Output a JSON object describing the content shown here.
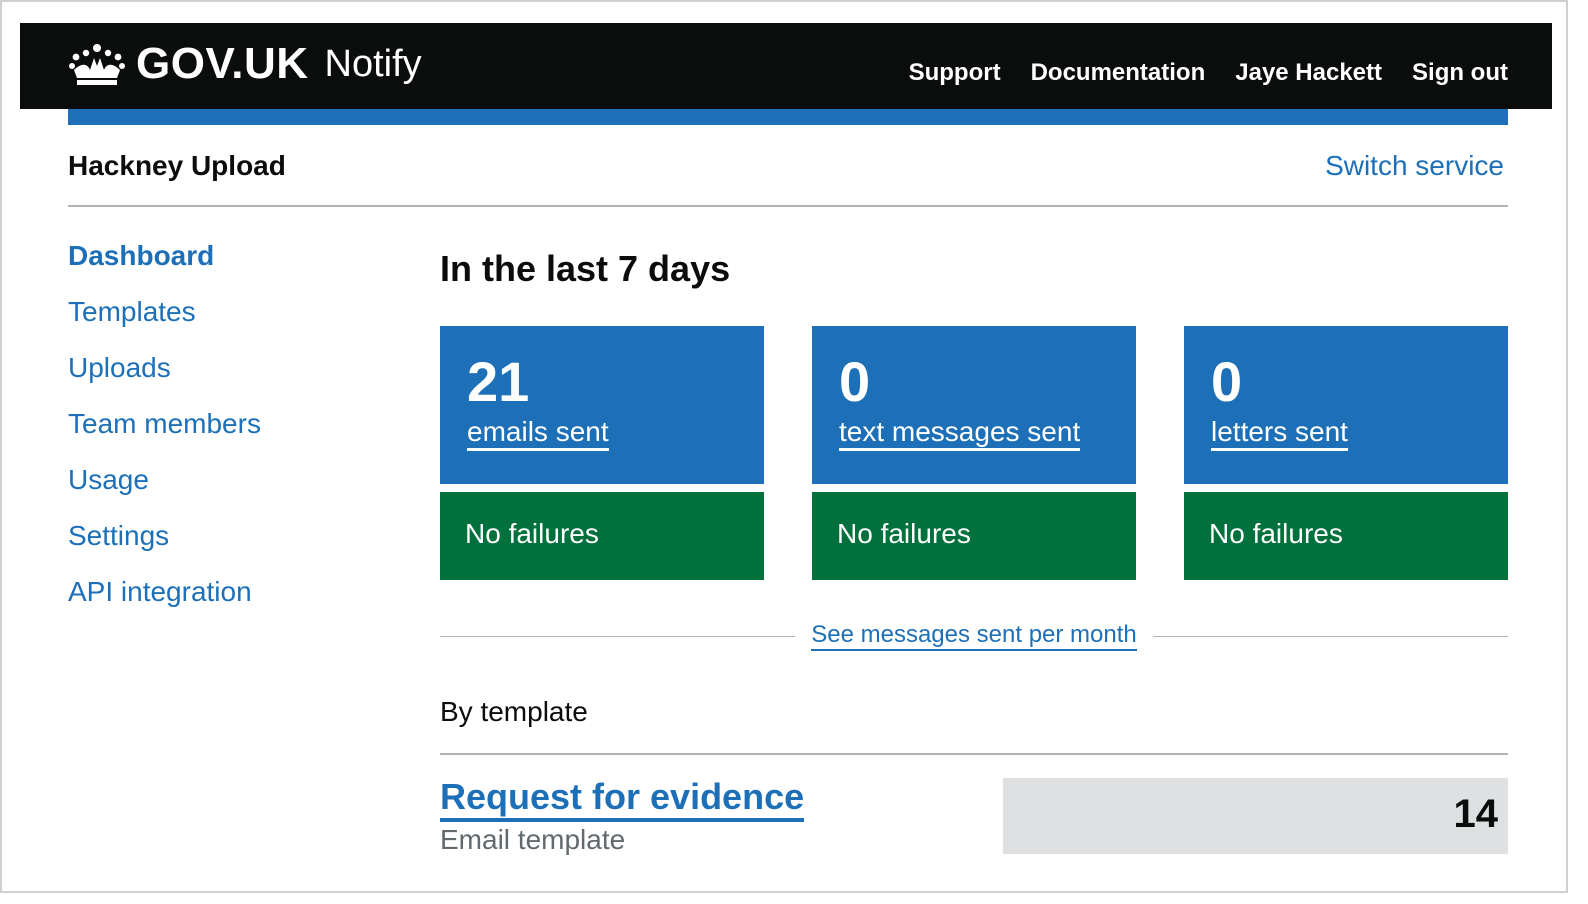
{
  "header": {
    "logo_text": "GOV.UK",
    "product_name": "Notify",
    "nav": [
      "Support",
      "Documentation",
      "Jaye Hackett",
      "Sign out"
    ]
  },
  "service": {
    "name": "Hackney Upload",
    "switch_label": "Switch service"
  },
  "sidebar": {
    "items": [
      {
        "label": "Dashboard",
        "active": true
      },
      {
        "label": "Templates"
      },
      {
        "label": "Uploads"
      },
      {
        "label": "Team members"
      },
      {
        "label": "Usage"
      },
      {
        "label": "Settings"
      },
      {
        "label": "API integration"
      }
    ]
  },
  "main": {
    "heading": "In the last 7 days",
    "tiles": [
      {
        "count": "21",
        "label": "emails sent",
        "status": "No failures"
      },
      {
        "count": "0",
        "label": "text messages sent",
        "status": "No failures"
      },
      {
        "count": "0",
        "label": "letters sent",
        "status": "No failures"
      }
    ],
    "monthly_link": "See messages sent per month",
    "by_template_heading": "By template",
    "templates": [
      {
        "name": "Request for evidence",
        "type": "Email template",
        "count": "14"
      }
    ]
  },
  "colors": {
    "header_bg": "#0b0c0c",
    "brand_blue": "#1d70b8",
    "success_green": "#00703c",
    "count_bg": "#dee0e2"
  },
  "icons": {
    "logo": "crown-icon"
  }
}
